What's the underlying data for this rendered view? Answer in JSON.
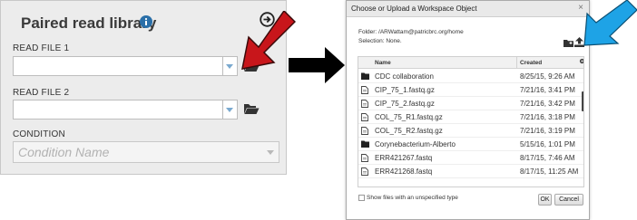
{
  "panel": {
    "title": "Paired read library",
    "read_file_1_label": "READ FILE 1",
    "read_file_2_label": "READ FILE 2",
    "condition_label": "CONDITION",
    "condition_placeholder": "Condition Name"
  },
  "dialog": {
    "title": "Choose or Upload a Workspace Object",
    "close_label": "×",
    "folder_line": "Folder: /ARWattam@patricbrc.org/home",
    "selection_line": "Selection: None.",
    "columns": [
      "Name",
      "Created"
    ],
    "rows": [
      {
        "type": "folder",
        "name": "CDC collaboration",
        "created": "8/25/15, 9:26 AM"
      },
      {
        "type": "file",
        "name": "CIP_75_1.fastq.gz",
        "created": "7/21/16, 3:41 PM"
      },
      {
        "type": "file",
        "name": "CIP_75_2.fastq.gz",
        "created": "7/21/16, 3:42 PM"
      },
      {
        "type": "file",
        "name": "COL_75_R1.fastq.gz",
        "created": "7/21/16, 3:18 PM"
      },
      {
        "type": "file",
        "name": "COL_75_R2.fastq.gz",
        "created": "7/21/16, 3:19 PM"
      },
      {
        "type": "folder",
        "name": "Corynebacterium-Alberto",
        "created": "5/15/16, 1:01 PM"
      },
      {
        "type": "file",
        "name": "ERR421267.fastq",
        "created": "8/17/15, 7:46 AM"
      },
      {
        "type": "file",
        "name": "ERR421268.fastq",
        "created": "8/17/15, 11:25 AM"
      }
    ],
    "show_files_label": "Show files with an unspecified type",
    "ok_label": "OK",
    "cancel_label": "Cancel"
  },
  "colors": {
    "panel_bg": "#ececec",
    "info_blue": "#2a6fa8",
    "red_arrow": "#c8161b",
    "blue_arrow": "#1ea3e6",
    "black_arrow": "#000000"
  },
  "icons": [
    "info-icon",
    "circle-arrow-icon",
    "folder-open-icon",
    "dropdown-caret-icon",
    "new-folder-icon",
    "upload-icon",
    "gear-icon",
    "folder-icon",
    "file-icon"
  ]
}
